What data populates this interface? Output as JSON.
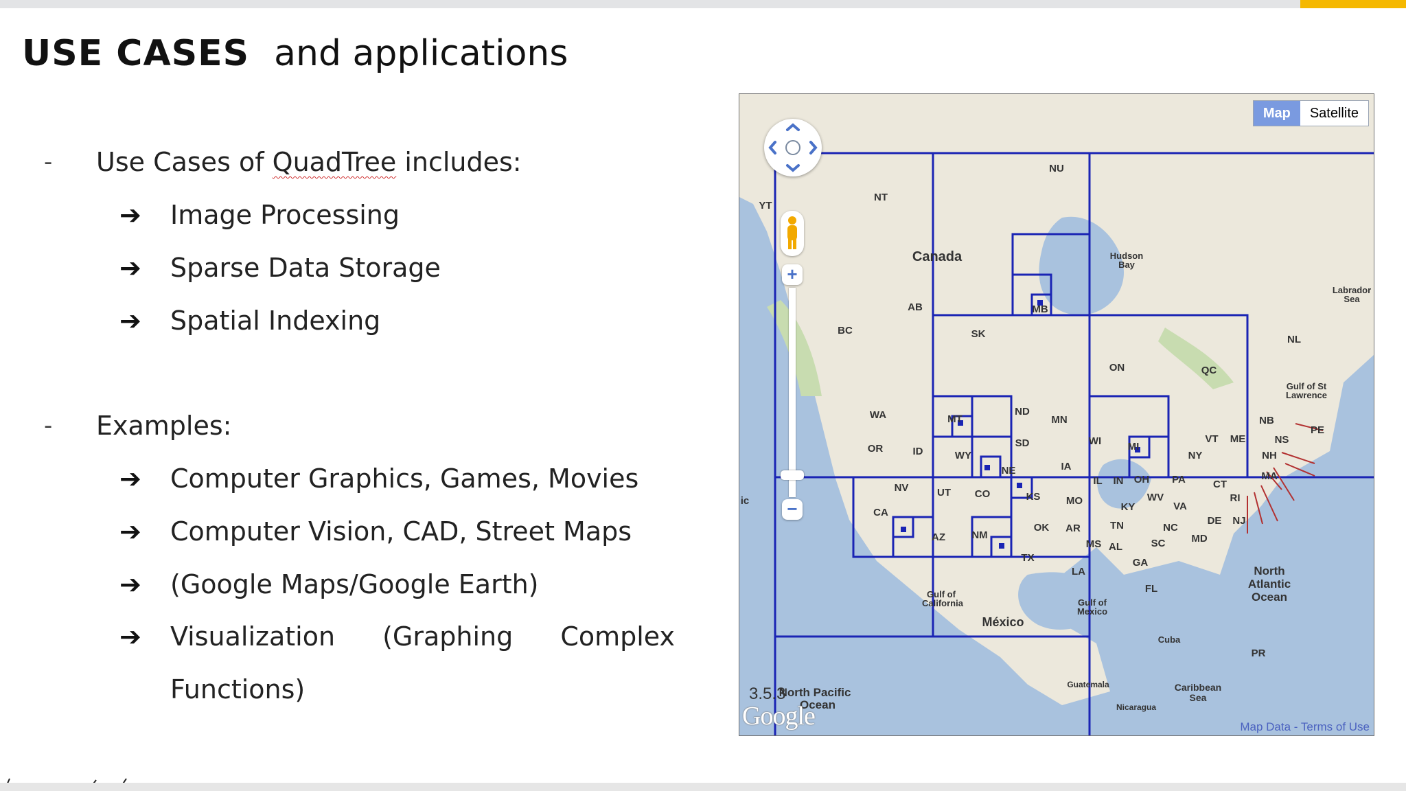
{
  "slide": {
    "title_bold": "USE CASES",
    "title_rest": "and applications",
    "section_use_cases": {
      "dash": "-",
      "heading_prefix": "Use Cases of ",
      "heading_term": "QuadTree",
      "heading_suffix": " includes:",
      "items": [
        "Image Processing",
        "Sparse Data Storage",
        "Spatial Indexing"
      ]
    },
    "section_examples": {
      "dash": "-",
      "heading": "Examples:",
      "items": [
        "Computer Graphics, Games, Movies",
        "Computer Vision, CAD, Street Maps",
        "(Google Maps/Google Earth)"
      ],
      "visualization_words": [
        "Visualization",
        "(Graphing",
        "Complex"
      ],
      "visualization_continued": "Functions)"
    },
    "arrow_glyph": "➔"
  },
  "map": {
    "buttons": {
      "map": "Map",
      "satellite": "Satellite"
    },
    "zoom_level": "3.5.3",
    "logo": "Google",
    "terms": "Map Data - Terms of Use",
    "colors": {
      "water": "#a9c2de",
      "land": "#ece8dc",
      "quadtree_lines": "#1a24b4",
      "active_button": "#7a9ae0"
    },
    "labels": {
      "nu": "NU",
      "nt": "NT",
      "yt": "YT",
      "canada": "Canada",
      "hudson_bay_1": "Hudson",
      "hudson_bay_2": "Bay",
      "labrador_1": "Labrador",
      "labrador_2": "Sea",
      "ab": "AB",
      "bc": "BC",
      "sk": "SK",
      "mb": "MB",
      "on": "ON",
      "qc": "QC",
      "nl": "NL",
      "gulf_st_1": "Gulf of St",
      "gulf_st_2": "Lawrence",
      "wa": "WA",
      "mt": "MT",
      "nd": "ND",
      "mn": "MN",
      "or": "OR",
      "id": "ID",
      "wy": "WY",
      "sd": "SD",
      "wi": "WI",
      "mi": "MI",
      "ny": "NY",
      "vt": "VT",
      "me": "ME",
      "nb": "NB",
      "ns": "NS",
      "pe": "PE",
      "nh": "NH",
      "ma": "MA",
      "ne": "NE",
      "ia": "IA",
      "ct": "CT",
      "ri": "RI",
      "pa": "PA",
      "nv": "NV",
      "ut": "UT",
      "co": "CO",
      "ks": "KS",
      "mo": "MO",
      "il": "IL",
      "in": "IN",
      "oh": "OH",
      "wv": "WV",
      "va": "VA",
      "nj": "NJ",
      "de": "DE",
      "md": "MD",
      "ca": "CA",
      "ky": "KY",
      "tn": "TN",
      "nc": "NC",
      "ok": "OK",
      "ar": "AR",
      "az": "AZ",
      "nm": "NM",
      "ms": "MS",
      "al": "AL",
      "sc": "SC",
      "ga": "GA",
      "tx": "TX",
      "la": "LA",
      "fl": "FL",
      "gulf_ca_1": "Gulf of",
      "gulf_ca_2": "California",
      "gulf_mx_1": "Gulf of",
      "gulf_mx_2": "Mexico",
      "mexico": "México",
      "cuba": "Cuba",
      "pr": "PR",
      "atlantic_1": "North",
      "atlantic_2": "Atlantic",
      "atlantic_3": "Ocean",
      "pacific_1": "North Pacific",
      "pacific_2": "Ocean",
      "guatemala": "Guatemala",
      "nicaragua": "Nicaragua",
      "caribbean_1": "Caribbean",
      "caribbean_2": "Sea",
      "ic": "ic"
    }
  }
}
